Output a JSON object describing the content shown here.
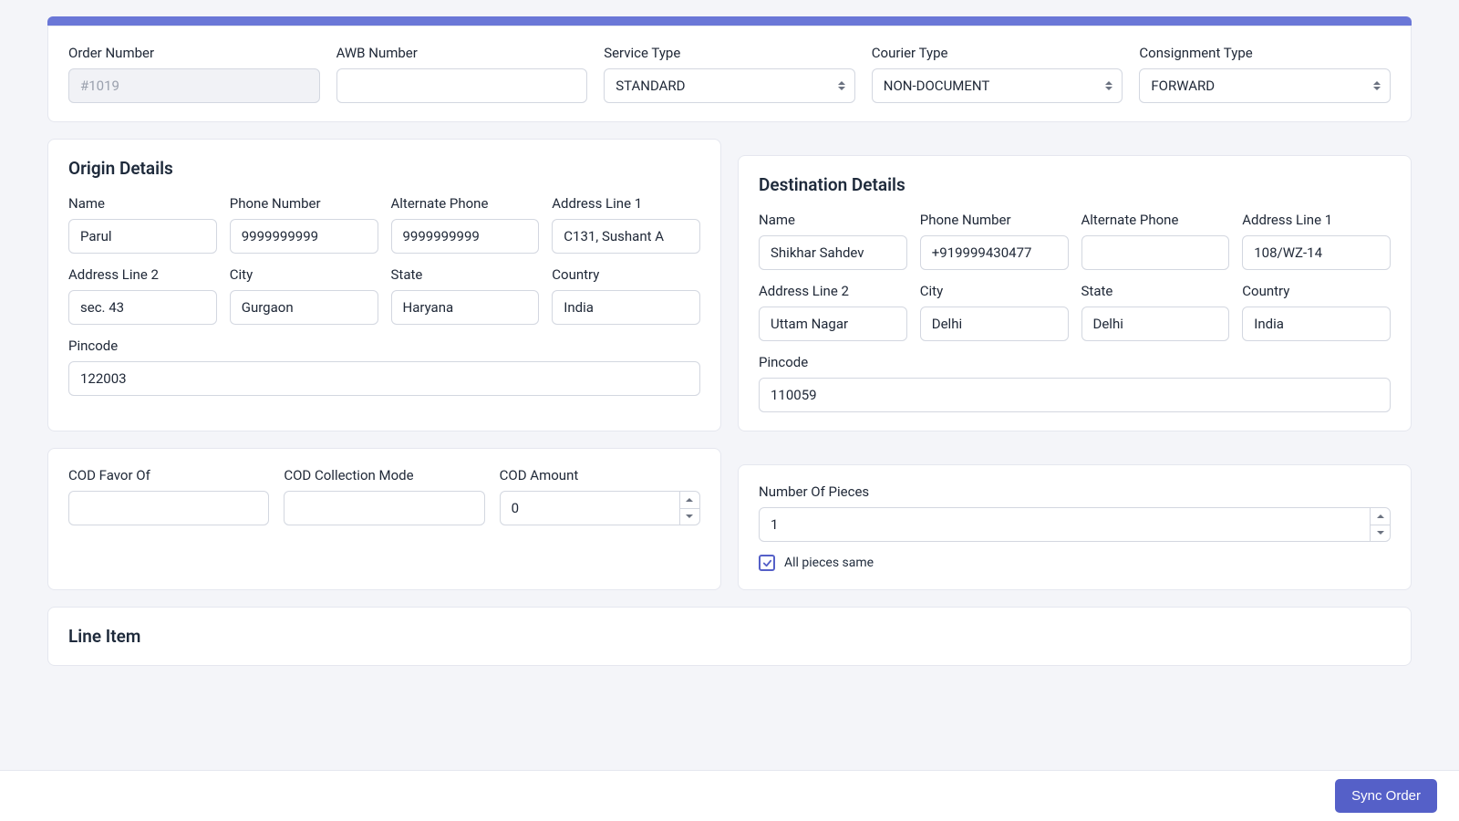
{
  "header": {
    "order_number_label": "Order Number",
    "order_number_value": "#1019",
    "awb_label": "AWB Number",
    "awb_value": "",
    "service_type_label": "Service Type",
    "service_type_value": "STANDARD",
    "courier_type_label": "Courier Type",
    "courier_type_value": "NON-DOCUMENT",
    "consignment_type_label": "Consignment Type",
    "consignment_type_value": "FORWARD"
  },
  "origin": {
    "title": "Origin Details",
    "name_label": "Name",
    "name_value": "Parul",
    "phone_label": "Phone Number",
    "phone_value": "9999999999",
    "alt_phone_label": "Alternate Phone",
    "alt_phone_value": "9999999999",
    "addr1_label": "Address Line 1",
    "addr1_value": "C131, Sushant A",
    "addr2_label": "Address Line 2",
    "addr2_value": "sec. 43",
    "city_label": "City",
    "city_value": "Gurgaon",
    "state_label": "State",
    "state_value": "Haryana",
    "country_label": "Country",
    "country_value": "India",
    "pincode_label": "Pincode",
    "pincode_value": "122003"
  },
  "destination": {
    "title": "Destination Details",
    "name_label": "Name",
    "name_value": "Shikhar Sahdev",
    "phone_label": "Phone Number",
    "phone_value": "+919999430477",
    "alt_phone_label": "Alternate Phone",
    "alt_phone_value": "",
    "addr1_label": "Address Line 1",
    "addr1_value": "108/WZ-14",
    "addr2_label": "Address Line 2",
    "addr2_value": "Uttam Nagar",
    "city_label": "City",
    "city_value": "Delhi",
    "state_label": "State",
    "state_value": "Delhi",
    "country_label": "Country",
    "country_value": "India",
    "pincode_label": "Pincode",
    "pincode_value": "110059"
  },
  "cod": {
    "favor_label": "COD Favor Of",
    "favor_value": "",
    "mode_label": "COD Collection Mode",
    "mode_value": "",
    "amount_label": "COD Amount",
    "amount_value": "0"
  },
  "pieces": {
    "label": "Number Of Pieces",
    "value": "1",
    "all_same_label": "All pieces same"
  },
  "line_item": {
    "title": "Line Item"
  },
  "footer": {
    "sync_label": "Sync Order"
  }
}
